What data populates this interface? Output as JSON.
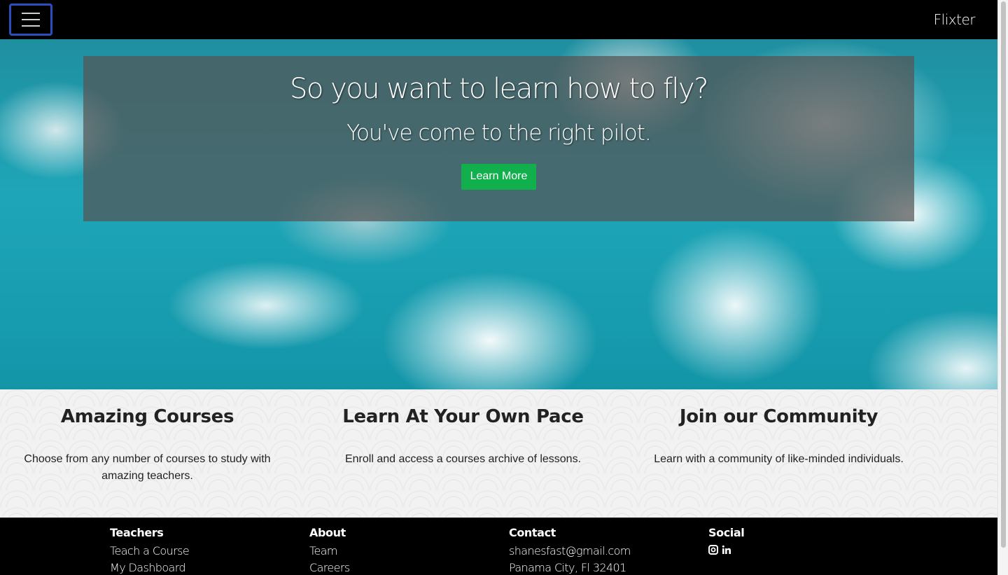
{
  "navbar": {
    "toggle_label": "Toggle navigation",
    "brand": "Flixter",
    "background": "#000000"
  },
  "hero": {
    "title": "So you want to learn how to fly?",
    "subtitle": "You've come to the right pilot.",
    "button_label": "Learn More",
    "button_color": "#12b04c"
  },
  "features": [
    {
      "heading": "Amazing Courses",
      "text": "Choose from any number of courses to study with amazing teachers."
    },
    {
      "heading": "Learn At Your Own Pace",
      "text": "Enroll and access a courses archive of lessons."
    },
    {
      "heading": "Join our Community",
      "text": "Learn with a community of like-minded individuals."
    }
  ],
  "footer": {
    "teachers": {
      "heading": "Teachers",
      "links": [
        "Teach a Course",
        "My Dashboard"
      ]
    },
    "about": {
      "heading": "About",
      "links": [
        "Team",
        "Careers"
      ]
    },
    "contact": {
      "heading": "Contact",
      "email": "shanesfast@gmail.com",
      "address": "Panama City, Fl 32401"
    },
    "social": {
      "heading": "Social",
      "icons": [
        "instagram-icon",
        "linkedin-icon"
      ]
    }
  }
}
